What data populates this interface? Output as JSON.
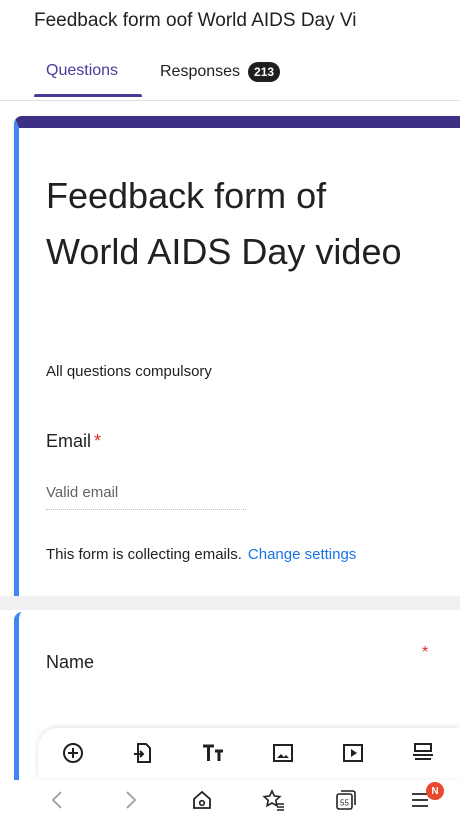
{
  "app": {
    "title": "Feedback form oof World AIDS Day Vi"
  },
  "tabs": {
    "questions": "Questions",
    "responses": "Responses",
    "responses_count": "213"
  },
  "form": {
    "title": "Feedback form of World AIDS Day video",
    "description": "All questions compulsory",
    "email_label": "Email",
    "required_mark": "*",
    "email_placeholder": "Valid email",
    "collect_note": "This form is collecting emails.",
    "change_settings": "Change settings"
  },
  "question": {
    "label": "Name",
    "required_mark": "*"
  },
  "toolbar": {
    "icons": [
      "add-question-icon",
      "import-questions-icon",
      "add-title-icon",
      "add-image-icon",
      "add-video-icon",
      "add-section-icon"
    ]
  },
  "navbar": {
    "icons": [
      "back-icon",
      "forward-icon",
      "home-icon",
      "favorites-icon",
      "tabs-icon",
      "menu-icon"
    ],
    "tabs_count": "55",
    "notification": "N"
  },
  "colors": {
    "accent": "#3d2f83",
    "tab_active": "#4a3b9a",
    "link": "#1a73e8",
    "required": "#d93025",
    "card_edge": "#4285f4"
  }
}
